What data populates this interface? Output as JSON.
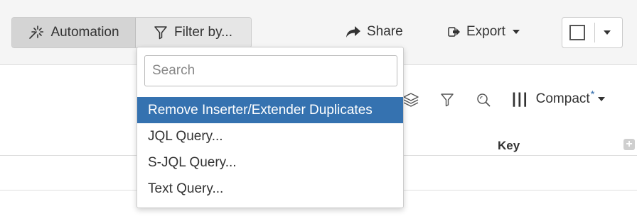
{
  "toolbar": {
    "automation_label": "Automation",
    "filter_label": "Filter by...",
    "share_label": "Share",
    "export_label": "Export"
  },
  "filter_dropdown": {
    "search_placeholder": "Search",
    "items": [
      {
        "label": "Remove Inserter/Extender Duplicates",
        "active": true
      },
      {
        "label": "JQL Query...",
        "active": false
      },
      {
        "label": "S-JQL Query...",
        "active": false
      },
      {
        "label": "Text Query...",
        "active": false
      }
    ]
  },
  "view": {
    "compact_label": "Compact",
    "modified_marker": "*"
  },
  "table": {
    "key_header": "Key",
    "add_column_symbol": "+"
  },
  "colors": {
    "accent": "#3572b0",
    "toolbar_bg": "#f5f5f5"
  },
  "icons": [
    "automation-icon",
    "filter-icon",
    "share-icon",
    "export-icon",
    "layers-icon",
    "search-icon",
    "columns-icon"
  ]
}
